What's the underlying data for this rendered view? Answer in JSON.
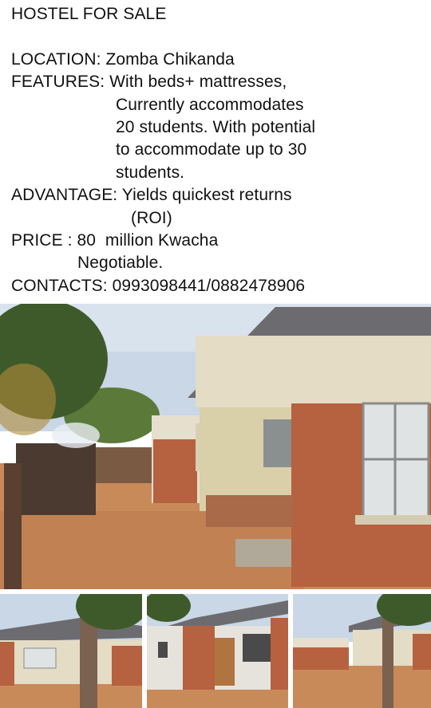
{
  "listing": {
    "title": "HOSTEL FOR SALE",
    "location_line": "LOCATION: Zomba Chikanda",
    "features_line1": "FEATURES: With beds+ mattresses,",
    "features_line2": "Currently accommodates",
    "features_line3": "20 students. With potential",
    "features_line4": "to accommodate up to 30",
    "features_line5": "students.",
    "advantage_line1": "ADVANTAGE: Yields quickest returns",
    "advantage_line2": "(ROI)",
    "price_line1": "PRICE : 80  million Kwacha",
    "price_line2": "Negotiable.",
    "contacts_line": "CONTACTS: 0993098441/0882478906"
  },
  "photos": {
    "main": "hostel-front-photo",
    "thumbs": [
      "hostel-side-photo",
      "hostel-room-door-photo",
      "hostel-yard-photo"
    ]
  },
  "colors": {
    "sky": "#c9d7e6",
    "wall": "#e4dcc4",
    "brick": "#b6613f",
    "ground": "#c98a5a",
    "roof": "#6c6c70",
    "tree": "#3f5a2a"
  }
}
